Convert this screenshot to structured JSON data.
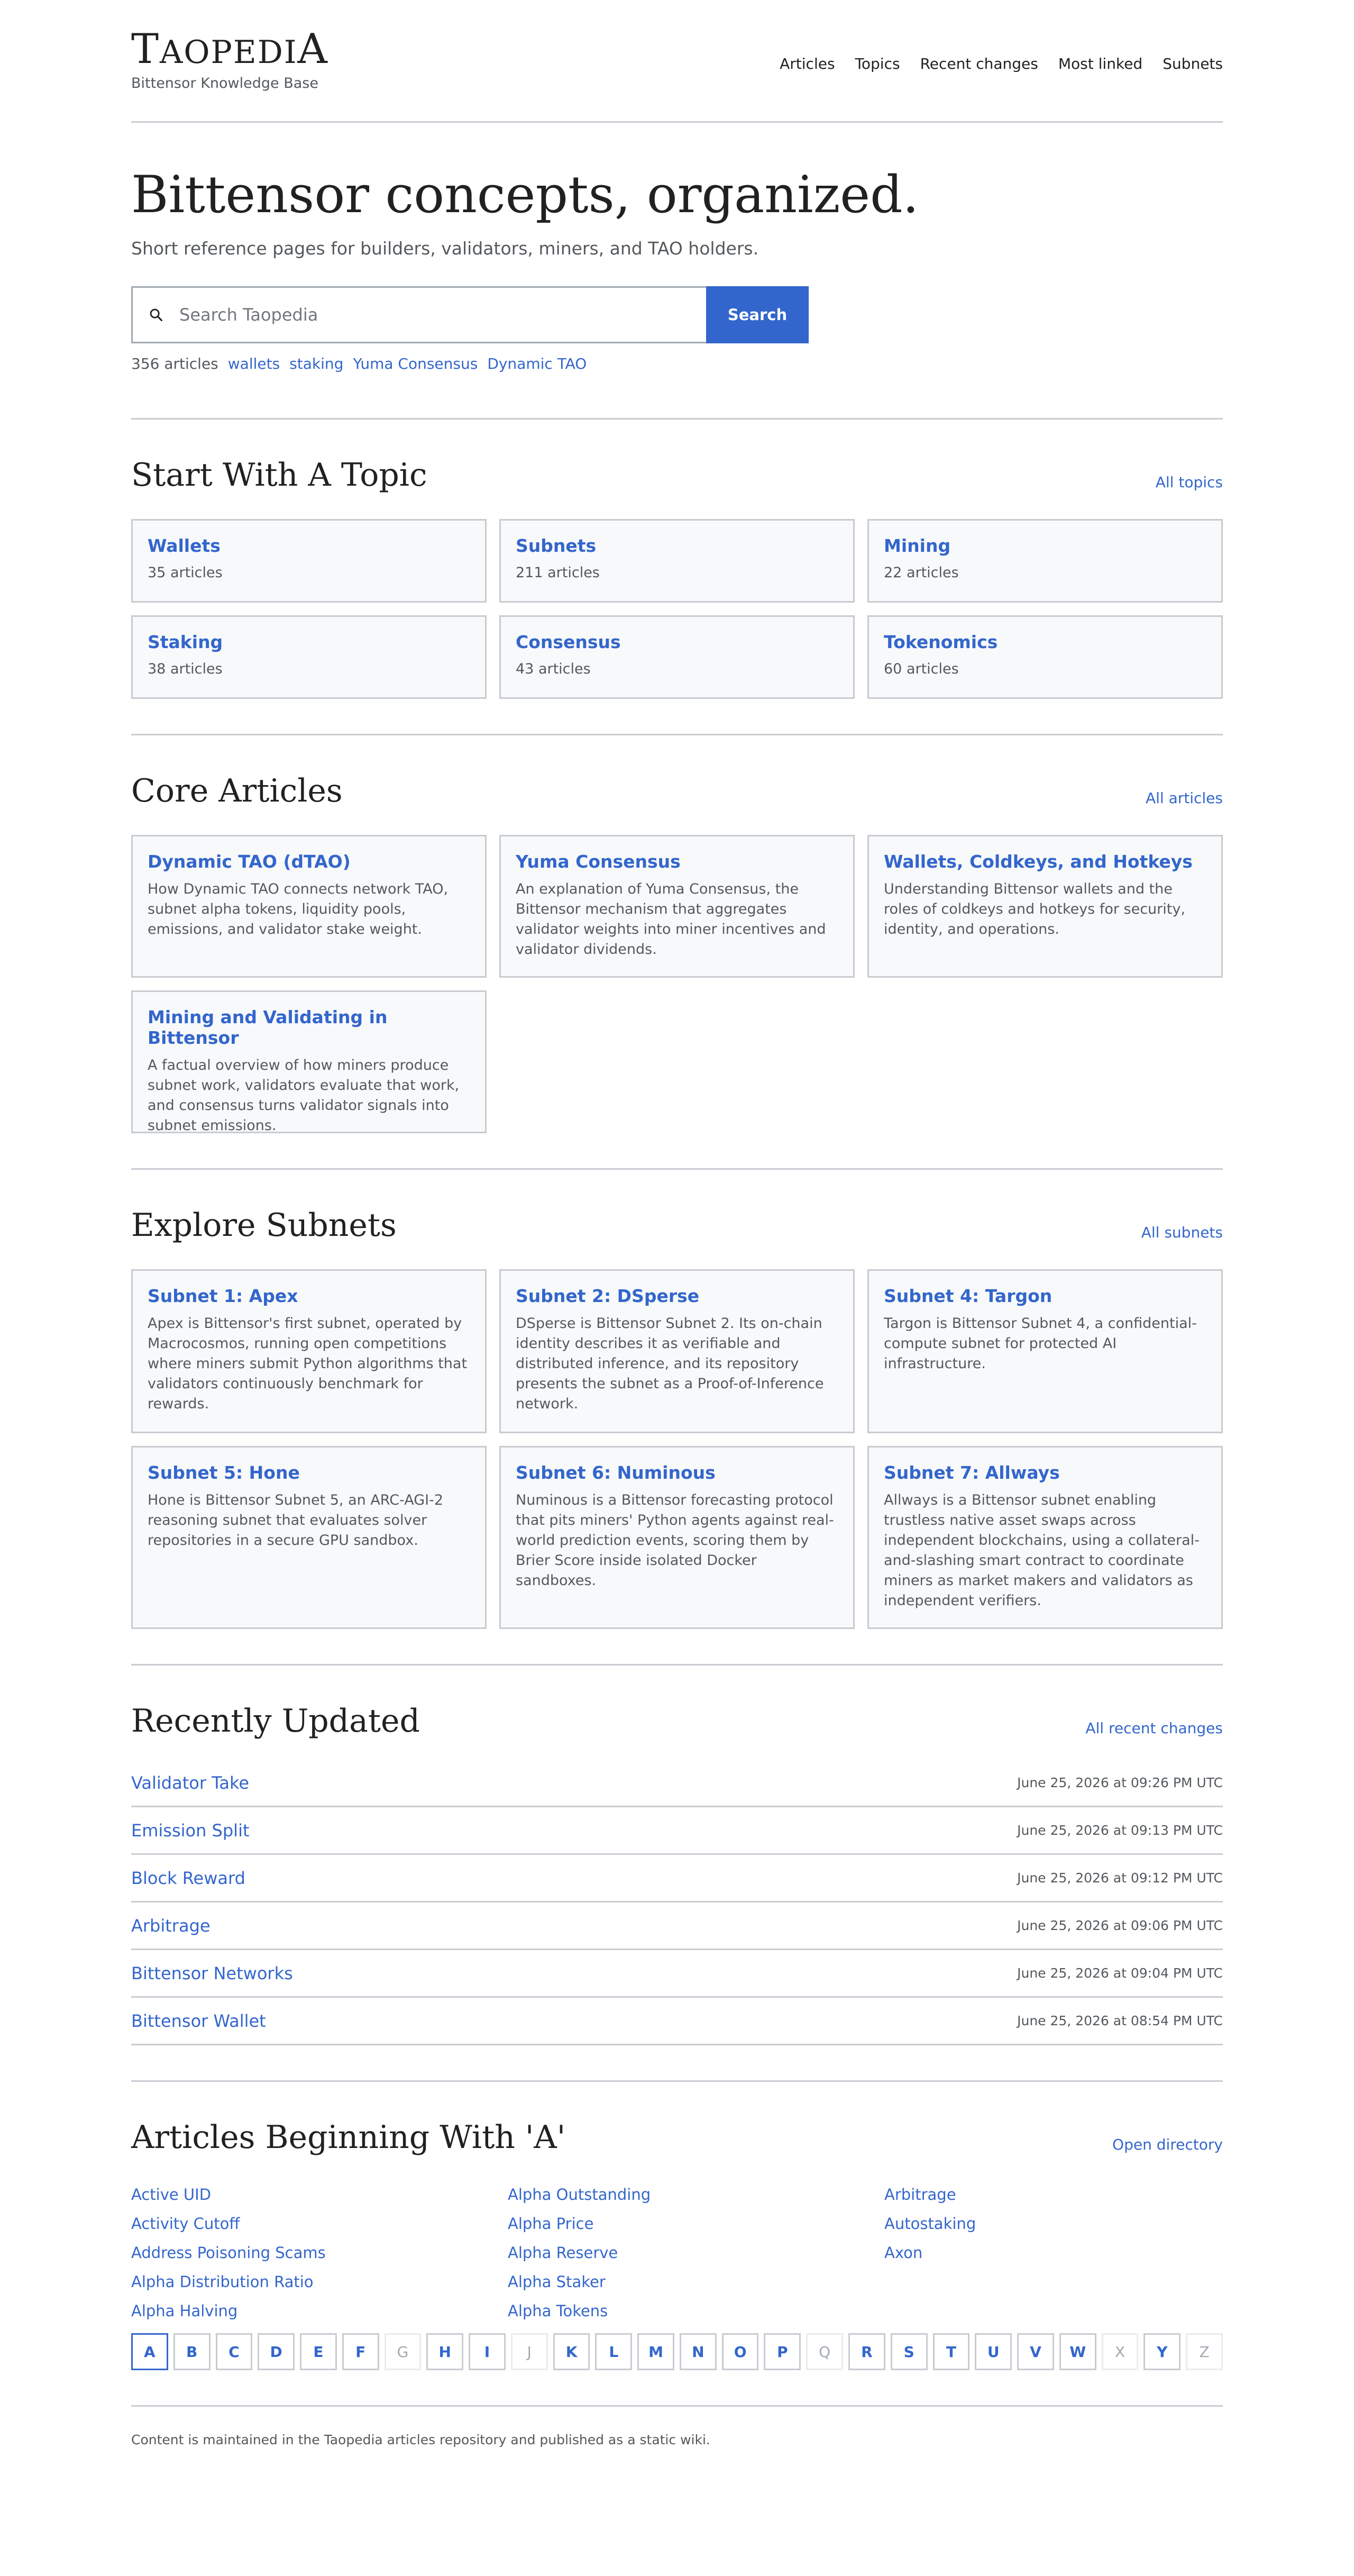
{
  "site": {
    "logo": "TaopediA",
    "tagline": "Bittensor Knowledge Base",
    "nav": [
      "Articles",
      "Topics",
      "Recent changes",
      "Most linked",
      "Subnets"
    ]
  },
  "hero": {
    "title": "Bittensor concepts, organized.",
    "subtitle": "Short reference pages for builders, validators, miners, and TAO holders.",
    "search_placeholder": "Search Taopedia",
    "search_button": "Search",
    "article_count": "356 articles",
    "quick_links": [
      "wallets",
      "staking",
      "Yuma Consensus",
      "Dynamic TAO"
    ]
  },
  "topics": {
    "heading": "Start With A Topic",
    "more": "All topics",
    "items": [
      {
        "name": "Wallets",
        "count": "35 articles"
      },
      {
        "name": "Subnets",
        "count": "211 articles"
      },
      {
        "name": "Mining",
        "count": "22 articles"
      },
      {
        "name": "Staking",
        "count": "38 articles"
      },
      {
        "name": "Consensus",
        "count": "43 articles"
      },
      {
        "name": "Tokenomics",
        "count": "60 articles"
      }
    ]
  },
  "core": {
    "heading": "Core Articles",
    "more": "All articles",
    "items": [
      {
        "title": "Dynamic TAO (dTAO)",
        "desc": "How Dynamic TAO connects network TAO, subnet alpha tokens, liquidity pools, emissions, and validator stake weight."
      },
      {
        "title": "Yuma Consensus",
        "desc": "An explanation of Yuma Consensus, the Bittensor mechanism that aggregates validator weights into miner incentives and validator dividends."
      },
      {
        "title": "Wallets, Coldkeys, and Hotkeys",
        "desc": "Understanding Bittensor wallets and the roles of coldkeys and hotkeys for security, identity, and operations."
      },
      {
        "title": "Mining and Validating in Bittensor",
        "desc": "A factual overview of how miners produce subnet work, validators evaluate that work, and consensus turns validator signals into subnet emissions."
      }
    ]
  },
  "subnets": {
    "heading": "Explore Subnets",
    "more": "All subnets",
    "items": [
      {
        "title": "Subnet 1: Apex",
        "desc": "Apex is Bittensor's first subnet, operated by Macrocosmos, running open competitions where miners submit Python algorithms that validators continuously benchmark for rewards."
      },
      {
        "title": "Subnet 2: DSperse",
        "desc": "DSperse is Bittensor Subnet 2. Its on-chain identity describes it as verifiable and distributed inference, and its repository presents the subnet as a Proof-of-Inference network."
      },
      {
        "title": "Subnet 4: Targon",
        "desc": "Targon is Bittensor Subnet 4, a confidential-compute subnet for protected AI infrastructure."
      },
      {
        "title": "Subnet 5: Hone",
        "desc": "Hone is Bittensor Subnet 5, an ARC-AGI-2 reasoning subnet that evaluates solver repositories in a secure GPU sandbox."
      },
      {
        "title": "Subnet 6: Numinous",
        "desc": "Numinous is a Bittensor forecasting protocol that pits miners' Python agents against real-world prediction events, scoring them by Brier Score inside isolated Docker sandboxes."
      },
      {
        "title": "Subnet 7: Allways",
        "desc": "Allways is a Bittensor subnet enabling trustless native asset swaps across independent blockchains, using a collateral-and-slashing smart contract to coordinate miners as market makers and validators as independent verifiers."
      }
    ]
  },
  "recent": {
    "heading": "Recently Updated",
    "more": "All recent changes",
    "items": [
      {
        "title": "Validator Take",
        "date": "June 25, 2026 at 09:26 PM UTC"
      },
      {
        "title": "Emission Split",
        "date": "June 25, 2026 at 09:13 PM UTC"
      },
      {
        "title": "Block Reward",
        "date": "June 25, 2026 at 09:12 PM UTC"
      },
      {
        "title": "Arbitrage",
        "date": "June 25, 2026 at 09:06 PM UTC"
      },
      {
        "title": "Bittensor Networks",
        "date": "June 25, 2026 at 09:04 PM UTC"
      },
      {
        "title": "Bittensor Wallet",
        "date": "June 25, 2026 at 08:54 PM UTC"
      }
    ]
  },
  "alist": {
    "heading": "Articles Beginning With 'A'",
    "more": "Open directory",
    "columns": [
      [
        "Active UID",
        "Activity Cutoff",
        "Address Poisoning Scams",
        "Alpha Distribution Ratio",
        "Alpha Halving"
      ],
      [
        "Alpha Outstanding",
        "Alpha Price",
        "Alpha Reserve",
        "Alpha Staker",
        "Alpha Tokens"
      ],
      [
        "Arbitrage",
        "Autostaking",
        "Axon"
      ]
    ],
    "letters": [
      "A",
      "B",
      "C",
      "D",
      "E",
      "F",
      "G",
      "H",
      "I",
      "J",
      "K",
      "L",
      "M",
      "N",
      "O",
      "P",
      "Q",
      "R",
      "S",
      "T",
      "U",
      "V",
      "W",
      "X",
      "Y",
      "Z"
    ],
    "disabled_letters": [
      "G",
      "J",
      "Q",
      "X",
      "Z"
    ],
    "active_letter": "A"
  },
  "footer": {
    "text": "Content is maintained in the Taopedia articles repository and published as a static wiki."
  }
}
